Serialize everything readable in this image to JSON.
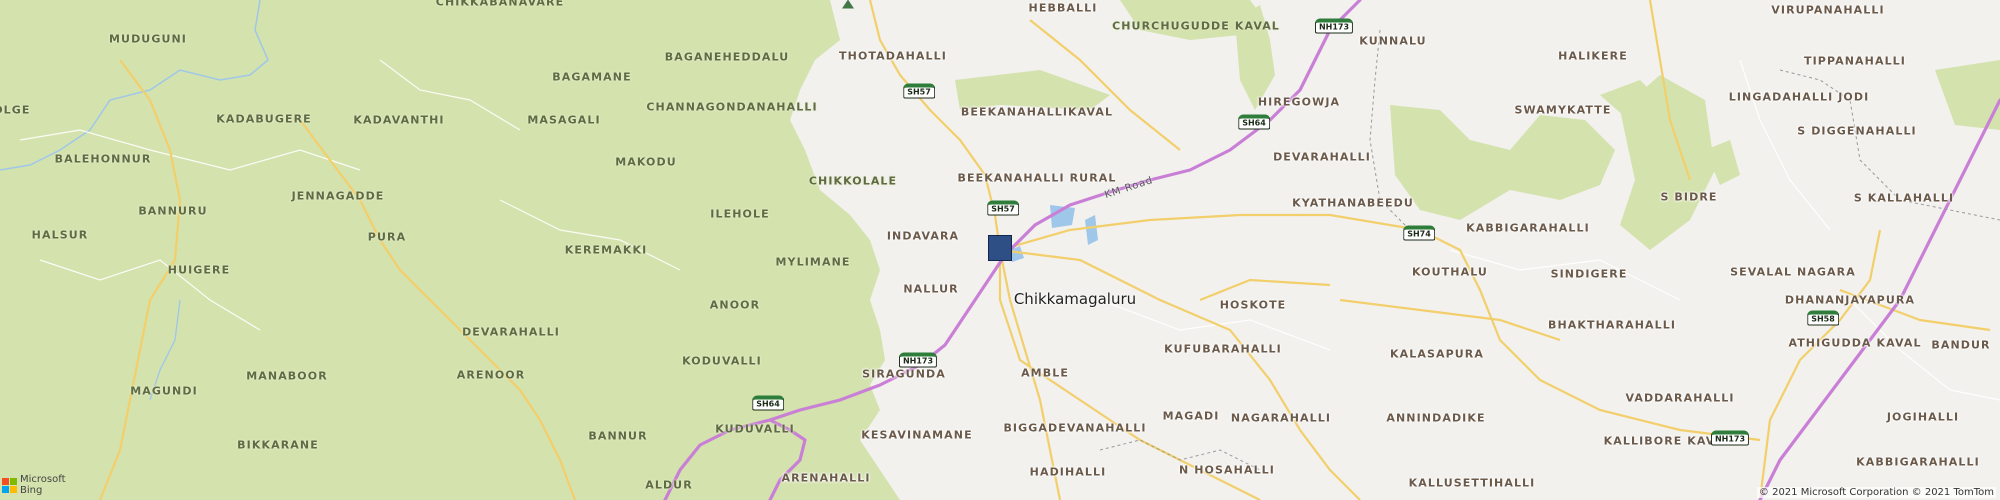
{
  "colors": {
    "land": "#f2f1ee",
    "forest": "#d4e2ad",
    "highway": "#c97fd6",
    "major_road": "#f2cf6b",
    "water": "#9ec7ea",
    "marker": "#2e4f86"
  },
  "places": [
    "CHIKKABANAVARE",
    "MUDUGUNI",
    "BAGANEHEDDALU",
    "THOTADAHALLI",
    "HEBBALLI",
    "CHURCHUGUDDE KAVAL",
    "KUNNALU",
    "HALIKERE",
    "VIRUPANAHALLI",
    "TIPPANAHALLI",
    "BAGAMANE",
    "CHANNAGONDANAHALLI",
    "KADABUGERE",
    "KADAVANTHI",
    "MASAGALI",
    "BEEKANAHALLIKAVAL",
    "HIREGOWJA",
    "SWAMYKATTE",
    "LINGADAHALLI JODI",
    "S DIGGENAHALLI",
    "BALEHONNUR",
    "MAKODU",
    "BEEKANAHALLI RURAL",
    "DEVARAHALLI",
    "CHIKKOLALE",
    "JENNAGADDE",
    "ILEHOLE",
    "BANNURU",
    "KYATHANABEEDU",
    "S BIDRE",
    "S KALLAHALLI",
    "HALSUR",
    "PURA",
    "INDAVARA",
    "KABBIGARAHALLI",
    "KEREMAKKI",
    "HUIGERE",
    "MYLIMANE",
    "KOUTHALU",
    "SINDIGERE",
    "SEVALAL NAGARA",
    "NALLUR",
    "ANOOR",
    "HOSKOTE",
    "DHANANJAYAPURA",
    "BHAKTHARAHALLI",
    "DEVARAHALLI",
    "KUFUBARAHALLI",
    "KODUVALLI",
    "KALASAPURA",
    "ATHIGUDDA KAVAL",
    "BANDUR",
    "MAGUNDI",
    "SIRAGUNDA",
    "AMBLE",
    "ARENOOR",
    "MANABOOR",
    "VADDARAHALLI",
    "JOGIHALLI",
    "BANNUR",
    "KUDUVALLI",
    "MAGADI",
    "NAGARAHALLI",
    "ANNINDADIKE",
    "BIKKARANE",
    "KESAVINAMANE",
    "BIGGADEVANAHALLI",
    "KABBIGARAHALLI",
    "KALLIBORE KAVAL",
    "HADIHALLI",
    "N HOSAHALLI",
    "ALDUR",
    "ARENAHALLI",
    "KALLUSETTIHALLI",
    "DLGE"
  ],
  "city": "Chikkamagaluru",
  "road_name": "KM Road",
  "shields": [
    "NH173",
    "SH57",
    "SH64",
    "SH57",
    "SH74",
    "SH58",
    "NH173",
    "SH64",
    "NH173"
  ],
  "logo": {
    "line1": "Microsoft",
    "line2": "Bing"
  },
  "copyright": "© 2021 Microsoft Corporation © 2021 TomTom"
}
